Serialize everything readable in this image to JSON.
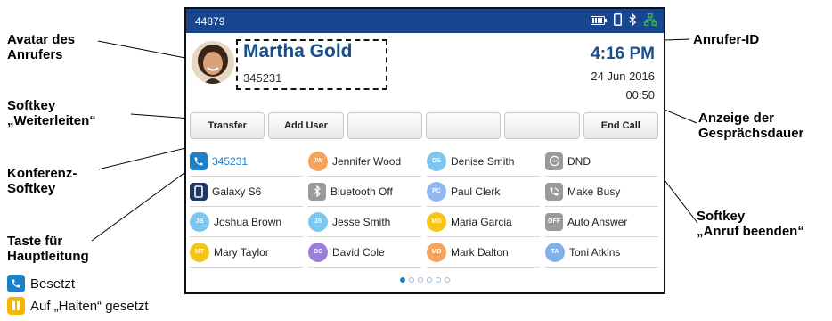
{
  "annotations": {
    "avatar": [
      "Avatar des",
      "Anrufers"
    ],
    "softkey_forward": [
      "Softkey",
      "„Weiterleiten“"
    ],
    "conference": [
      "Konferenz-",
      "Softkey"
    ],
    "main_line": [
      "Taste für",
      "Hauptleitung"
    ],
    "caller_id": [
      "Anrufer-ID"
    ],
    "duration": [
      "Anzeige der",
      "Gesprächsdauer"
    ],
    "end_call": [
      "Softkey",
      "„Anruf beenden“"
    ]
  },
  "legend": [
    {
      "label": "Besetzt",
      "color": "#1d7fc8",
      "icon": "phone-handset-icon"
    },
    {
      "label": "Auf „Halten“ gesetzt",
      "color": "#f2b705",
      "icon": "pause-icon"
    }
  ],
  "status_bar": {
    "extension": "44879",
    "icons": [
      "headset-battery-icon",
      "mobile-phone-icon",
      "bluetooth-icon",
      "network-icon"
    ],
    "network_color": "#3cba54"
  },
  "call": {
    "caller_name": "Martha Gold",
    "caller_number": "345231",
    "time": "4:16 PM",
    "date": "24 Jun 2016",
    "duration": "00:50"
  },
  "softkeys": [
    {
      "label": "Transfer"
    },
    {
      "label": "Add User"
    },
    {
      "label": ""
    },
    {
      "label": ""
    },
    {
      "label": ""
    },
    {
      "label": "End Call"
    }
  ],
  "line_keys": [
    {
      "label": "345231",
      "kind": "line",
      "color": "#1d7fc8"
    },
    {
      "label": "Jennifer Wood",
      "kind": "badge",
      "initials": "JW",
      "color": "#f5a25d"
    },
    {
      "label": "Denise Smith",
      "kind": "badge",
      "initials": "DS",
      "color": "#7fc6ee"
    },
    {
      "label": "DND",
      "kind": "dnd",
      "color": "#9a9a9a"
    },
    {
      "label": "Galaxy S6",
      "kind": "mobile",
      "color": "#1f3864"
    },
    {
      "label": "Bluetooth Off",
      "kind": "bluetooth",
      "color": "#9a9a9a"
    },
    {
      "label": "Paul Clerk",
      "kind": "badge",
      "initials": "PC",
      "color": "#8fb7f2"
    },
    {
      "label": "Make Busy",
      "kind": "busy",
      "color": "#9a9a9a"
    },
    {
      "label": "Joshua Brown",
      "kind": "badge",
      "initials": "JB",
      "color": "#7fc6ee"
    },
    {
      "label": "Jesse Smith",
      "kind": "badge",
      "initials": "JS",
      "color": "#7fc6ee"
    },
    {
      "label": "Maria Garcia",
      "kind": "badge",
      "initials": "MG",
      "color": "#f5c518"
    },
    {
      "label": "Auto Answer",
      "kind": "off",
      "text": "OFF",
      "color": "#9a9a9a"
    },
    {
      "label": "Mary Taylor",
      "kind": "badge",
      "initials": "MT",
      "color": "#f5c518"
    },
    {
      "label": "David Cole",
      "kind": "badge",
      "initials": "DC",
      "color": "#9b7fd4"
    },
    {
      "label": "Mark Dalton",
      "kind": "badge",
      "initials": "MD",
      "color": "#f5a25d"
    },
    {
      "label": "Toni Atkins",
      "kind": "badge",
      "initials": "TA",
      "color": "#7fb0e8"
    }
  ],
  "pages": {
    "count": 6,
    "active": 1
  }
}
